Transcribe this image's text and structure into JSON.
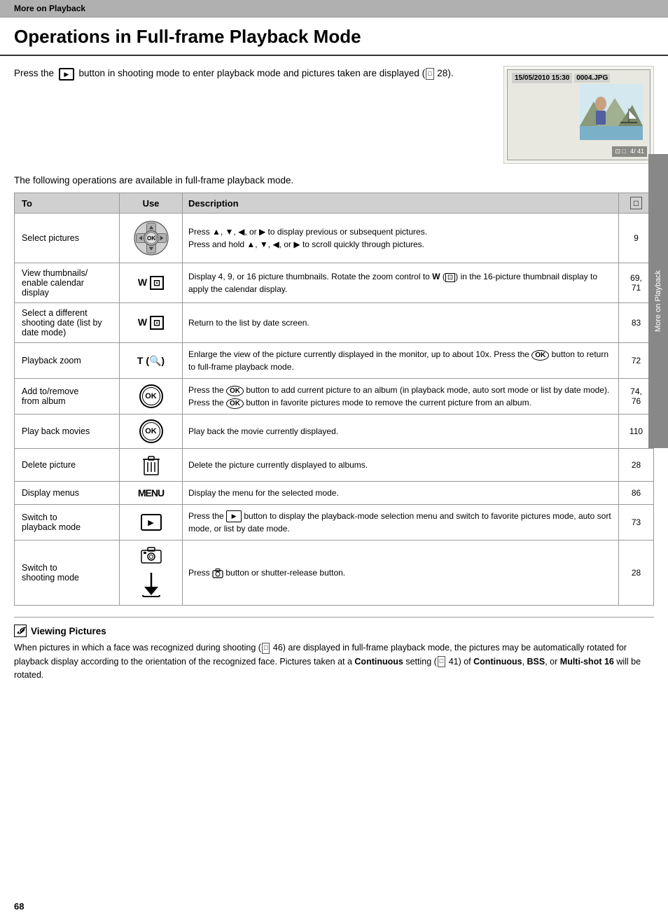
{
  "section_header": "More on Playback",
  "page_title": "Operations in Full-frame Playback Mode",
  "intro": {
    "text_part1": "Press the",
    "text_part2": "button in shooting mode to enter playback mode and pictures taken are displayed (",
    "text_ref": "28",
    "text_end": ").",
    "play_icon": "▶"
  },
  "camera_preview": {
    "datetime": "15/05/2010 15:30",
    "filename": "0004.JPG",
    "counter": "4/ 41"
  },
  "operations_intro": "The following operations are available in full-frame playback mode.",
  "table": {
    "headers": {
      "to": "To",
      "use": "Use",
      "description": "Description",
      "ref": "📖"
    },
    "rows": [
      {
        "id": "select-pictures",
        "to": "Select pictures",
        "use_type": "dpad",
        "description": "Press ▲, ▼, ◀, or ▶ to display previous or subsequent pictures.\nPress and hold ▲, ▼, ◀, or ▶ to scroll quickly through pictures.",
        "ref": "9"
      },
      {
        "id": "view-thumbnails",
        "to": "View thumbnails/\nenable calendar\ndisplay",
        "use_type": "w-bracket",
        "use_label": "W (⊡)",
        "description": "Display 4, 9, or 16 picture thumbnails. Rotate the zoom control to W (⊡) in the 16-picture thumbnail display to apply the calendar display.",
        "ref": "69, 71"
      },
      {
        "id": "select-date",
        "to": "Select a different shooting date (list by date mode)",
        "use_type": "w-bracket",
        "use_label": "W (⊡)",
        "description": "Return to the list by date screen.",
        "ref": "83"
      },
      {
        "id": "playback-zoom",
        "to": "Playback zoom",
        "use_type": "t-bracket",
        "use_label": "T (🔍)",
        "description": "Enlarge the view of the picture currently displayed in the monitor, up to about 10x. Press the ⊛ button to return to full-frame playback mode.",
        "ref": "72"
      },
      {
        "id": "add-remove-album",
        "to": "Add to/remove\nfrom album",
        "use_type": "ok-circle",
        "description": "Press the ⊛ button to add current picture to an album (in playback mode, auto sort mode or list by date mode). Press the ⊛ button in favorite pictures mode to remove the current picture from an album.",
        "ref": "74, 76"
      },
      {
        "id": "play-movies",
        "to": "Play back movies",
        "use_type": "ok-double",
        "description": "Play back the movie currently displayed.",
        "ref": "110"
      },
      {
        "id": "delete-picture",
        "to": "Delete picture",
        "use_type": "trash",
        "description": "Delete the picture currently displayed to albums.",
        "ref": "28"
      },
      {
        "id": "display-menus",
        "to": "Display menus",
        "use_type": "menu",
        "use_label": "MENU",
        "description": "Display the menu for the selected mode.",
        "ref": "86"
      },
      {
        "id": "switch-playback",
        "to": "Switch to playback mode",
        "use_type": "play-btn",
        "description": "Press the ▶ button to display the playback-mode selection menu and switch to favorite pictures mode, auto sort mode, or list by date mode.",
        "ref": "73"
      },
      {
        "id": "switch-shooting",
        "to": "Switch to\nshooting mode",
        "use_type": "camera-shutter",
        "description": "Press 🔷 button or shutter-release button.",
        "ref": "28"
      }
    ]
  },
  "note": {
    "title": "Viewing Pictures",
    "text": "When pictures in which a face was recognized during shooting (",
    "ref1": "46",
    "text2": ") are displayed in full-frame playback mode, the pictures may be automatically rotated for playback display according to the orientation of the recognized face. Pictures taken at a ",
    "bold1": "Continuous",
    "text3": " setting (",
    "ref2": "41",
    "text4": ") of ",
    "bold2": "Continuous",
    "text5": ", ",
    "bold3": "BSS",
    "text6": ", or ",
    "bold4": "Multi-shot 16",
    "text7": " will be rotated."
  },
  "page_number": "68",
  "side_tab_label": "More on Playback"
}
